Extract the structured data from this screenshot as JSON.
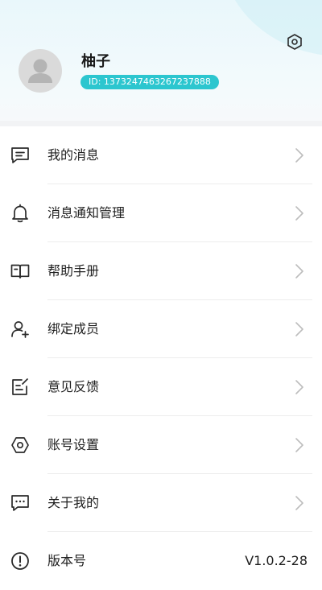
{
  "profile": {
    "name": "柚子",
    "id_label": "ID: 1373247463267237888"
  },
  "menu": {
    "items": [
      {
        "label": "我的消息",
        "icon": "message-icon"
      },
      {
        "label": "消息通知管理",
        "icon": "bell-icon"
      },
      {
        "label": "帮助手册",
        "icon": "book-icon"
      },
      {
        "label": "绑定成员",
        "icon": "add-user-icon"
      },
      {
        "label": "意见反馈",
        "icon": "feedback-icon"
      },
      {
        "label": "账号设置",
        "icon": "hexagon-settings-icon"
      },
      {
        "label": "关于我的",
        "icon": "chat-dots-icon"
      }
    ],
    "version": {
      "label": "版本号",
      "value": "V1.0.2-28",
      "icon": "info-icon"
    }
  },
  "colors": {
    "accent": "#2cc6cf",
    "header_bg": "#eaf7fb",
    "separator": "#f2f3f5"
  }
}
